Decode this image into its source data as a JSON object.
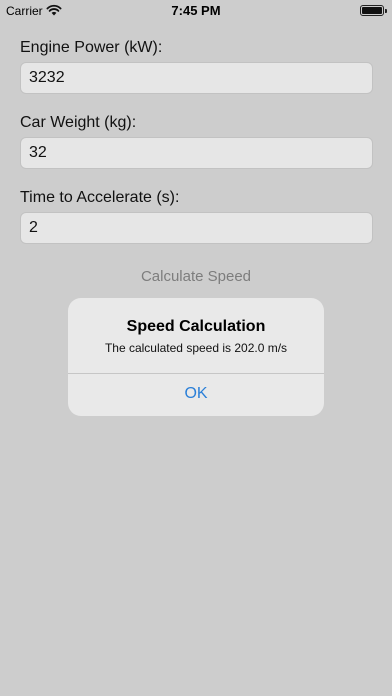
{
  "status_bar": {
    "carrier": "Carrier",
    "time": "7:45 PM"
  },
  "form": {
    "engine_power_label": "Engine Power (kW):",
    "engine_power_value": "3232",
    "car_weight_label": "Car Weight (kg):",
    "car_weight_value": "32",
    "time_label": "Time to Accelerate (s):",
    "time_value": "2",
    "calculate_label": "Calculate Speed"
  },
  "alert": {
    "title": "Speed Calculation",
    "message": "The calculated speed is 202.0 m/s",
    "ok_label": "OK"
  },
  "colors": {
    "background": "#cdcdcd",
    "alert_background": "#e9e9e9",
    "accent": "#2a7fd8",
    "disabled_text": "#7d7d7d"
  },
  "icons": [
    "wifi-icon",
    "battery-icon"
  ]
}
